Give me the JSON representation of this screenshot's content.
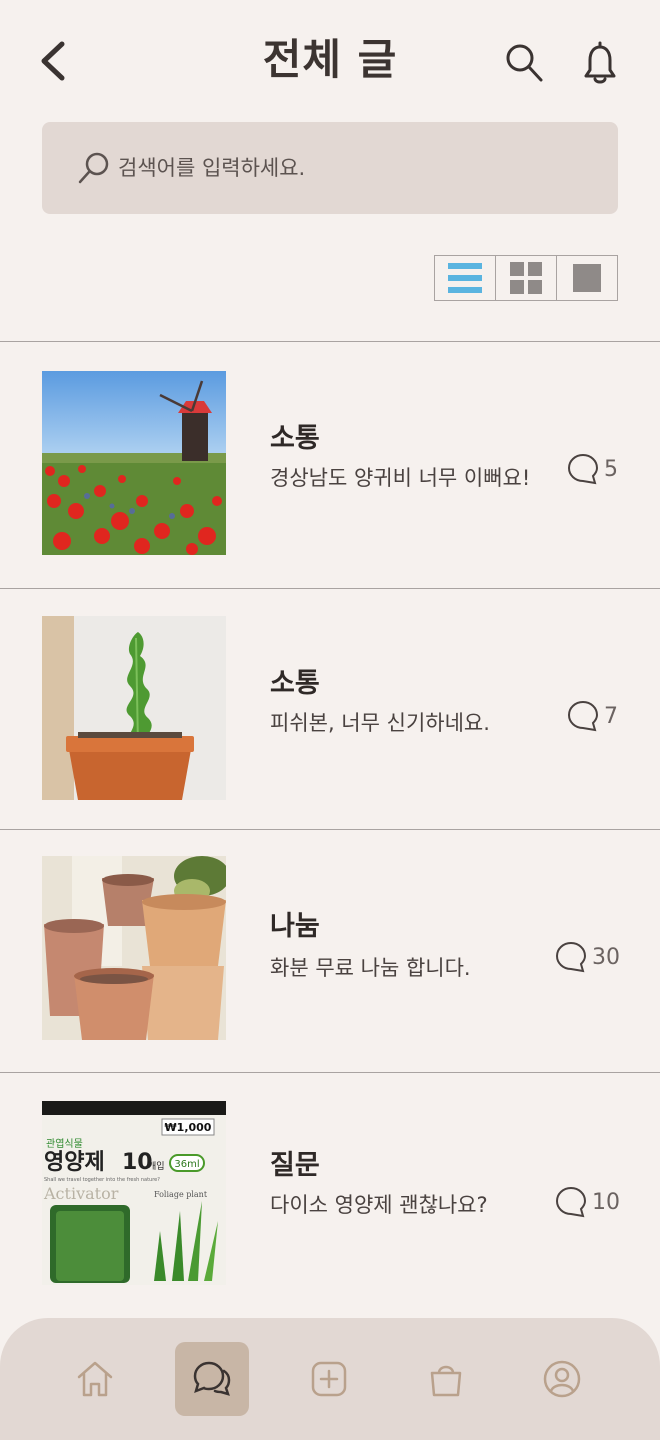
{
  "header": {
    "title": "전체 글",
    "back_icon": "chevron-left-icon",
    "search_icon": "search-icon",
    "bell_icon": "bell-icon"
  },
  "search": {
    "placeholder": "검색어를 입력하세요.",
    "value": ""
  },
  "view_modes": [
    {
      "icon": "list-view-icon",
      "active": true
    },
    {
      "icon": "grid-view-icon",
      "active": false
    },
    {
      "icon": "single-view-icon",
      "active": false
    }
  ],
  "posts": [
    {
      "category": "소통",
      "text": "경상남도 양귀비 너무 이뻐요!",
      "comments": "5",
      "image": "poppy-field-windmill-photo"
    },
    {
      "category": "소통",
      "text": "피쉬본, 너무 신기하네요.",
      "comments": "7",
      "image": "fishbone-cactus-photo"
    },
    {
      "category": "나눔",
      "text": "화분 무료 나눔 합니다.",
      "comments": "30",
      "image": "terracotta-pots-photo"
    },
    {
      "category": "질문",
      "text": "다이소 영양제 괜찮나요?",
      "comments": "10",
      "image": "plant-nutrient-box-photo"
    }
  ],
  "tabbar": [
    {
      "icon": "home-icon",
      "active": false
    },
    {
      "icon": "chat-icon",
      "active": true
    },
    {
      "icon": "add-icon",
      "active": false
    },
    {
      "icon": "shopping-bag-icon",
      "active": false
    },
    {
      "icon": "profile-icon",
      "active": false
    }
  ],
  "colors": {
    "background": "#f6f1ee",
    "search_bg": "#e2d8d3",
    "tab_active": "#c8b6a6",
    "accent_blue": "#5ab4e0"
  },
  "photo_text": {
    "price": "₩1,000",
    "brand": "관엽식물",
    "product": "영양제",
    "count": "10",
    "count_unit": "개입",
    "volume": "36ml",
    "slogan": "Shall we travel together into the fresh nature?",
    "activator": "Activator",
    "foliage": "Foliage plant"
  }
}
